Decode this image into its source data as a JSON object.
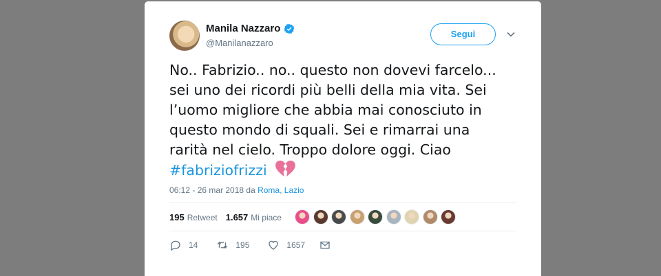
{
  "user": {
    "name": "Manila Nazzaro",
    "handle": "@Manilanazzaro",
    "follow_label": "Segui"
  },
  "tweet": {
    "lines": [
      "No.. Fabrizio.. no.. questo non dovevi farcelo...",
      "sei uno dei ricordi più belli della mia vita. Sei",
      "l’uomo migliore che abbia mai conosciuto in",
      "questo mondo di squali. Sei e rimarrai una",
      "rarità nel cielo. Troppo dolore oggi. Ciao"
    ],
    "hashtag": "#fabriziofrizzi",
    "emoji": "broken-heart"
  },
  "meta": {
    "time": "06:12 - 26 mar 2018 da ",
    "location": "Roma, Lazio"
  },
  "stats": {
    "retweets": "195",
    "retweets_label": "Retweet",
    "likes": "1.657",
    "likes_label": "Mi piace"
  },
  "actions": {
    "replies": "14",
    "retweets": "195",
    "likes": "1657"
  },
  "colors": {
    "accent": "#1da1f2",
    "link": "#1b95e0",
    "background": "#7d7d7d",
    "broken_heart": "#e8719a"
  },
  "likers": [
    {
      "icon": "liker-avatar",
      "color": "#e94e8a"
    },
    {
      "icon": "liker-avatar",
      "color": "#5a3a2e"
    },
    {
      "icon": "liker-avatar",
      "color": "#4a4a4a"
    },
    {
      "icon": "liker-avatar",
      "color": "#c9a070"
    },
    {
      "icon": "liker-avatar",
      "color": "#3a4a3a"
    },
    {
      "icon": "liker-avatar",
      "color": "#aab4be"
    },
    {
      "icon": "liker-avatar",
      "color": "#e0d4b0"
    },
    {
      "icon": "liker-avatar",
      "color": "#b08a6a"
    },
    {
      "icon": "liker-avatar",
      "color": "#6a3a30"
    }
  ]
}
